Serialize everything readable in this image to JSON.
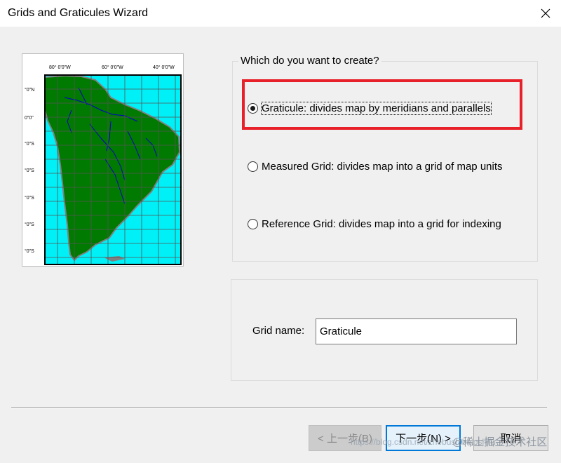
{
  "window": {
    "title": "Grids and Graticules Wizard",
    "close_icon": "close-icon"
  },
  "preview": {
    "icon": "south-america-graticule-map",
    "top_ticks": [
      "80° 0'0\"W",
      "60° 0'0\"W",
      "40° 0'0\"W"
    ],
    "left_ticks": [
      "°0\"N",
      "0\"0\"",
      "°0\"S",
      "°0\"S",
      "°0\"S",
      "°0\"S",
      "°0\"S"
    ],
    "colors": {
      "ocean": "#00f0f7",
      "land": "#007a00",
      "coast": "#808080",
      "rivers": "#0000c8"
    }
  },
  "create_group": {
    "caption": "Which do you want to create?",
    "options": [
      {
        "label": "Graticule: divides map by meridians and parallels",
        "checked": true
      },
      {
        "label": "Measured Grid: divides map into a grid of map units",
        "checked": false
      },
      {
        "label": "Reference Grid: divides map into a grid for indexing",
        "checked": false
      }
    ],
    "highlight_color": "#e8202a"
  },
  "grid_name": {
    "label": "Grid name:",
    "value": "Graticule"
  },
  "buttons": {
    "back": "< 上一步(B)",
    "next": "下一步(N) >",
    "cancel": "取消"
  },
  "watermark": {
    "url": "https://blog.csdn.net/zhebushibiaoshifu",
    "brand": "@稀土掘金技术社区"
  }
}
